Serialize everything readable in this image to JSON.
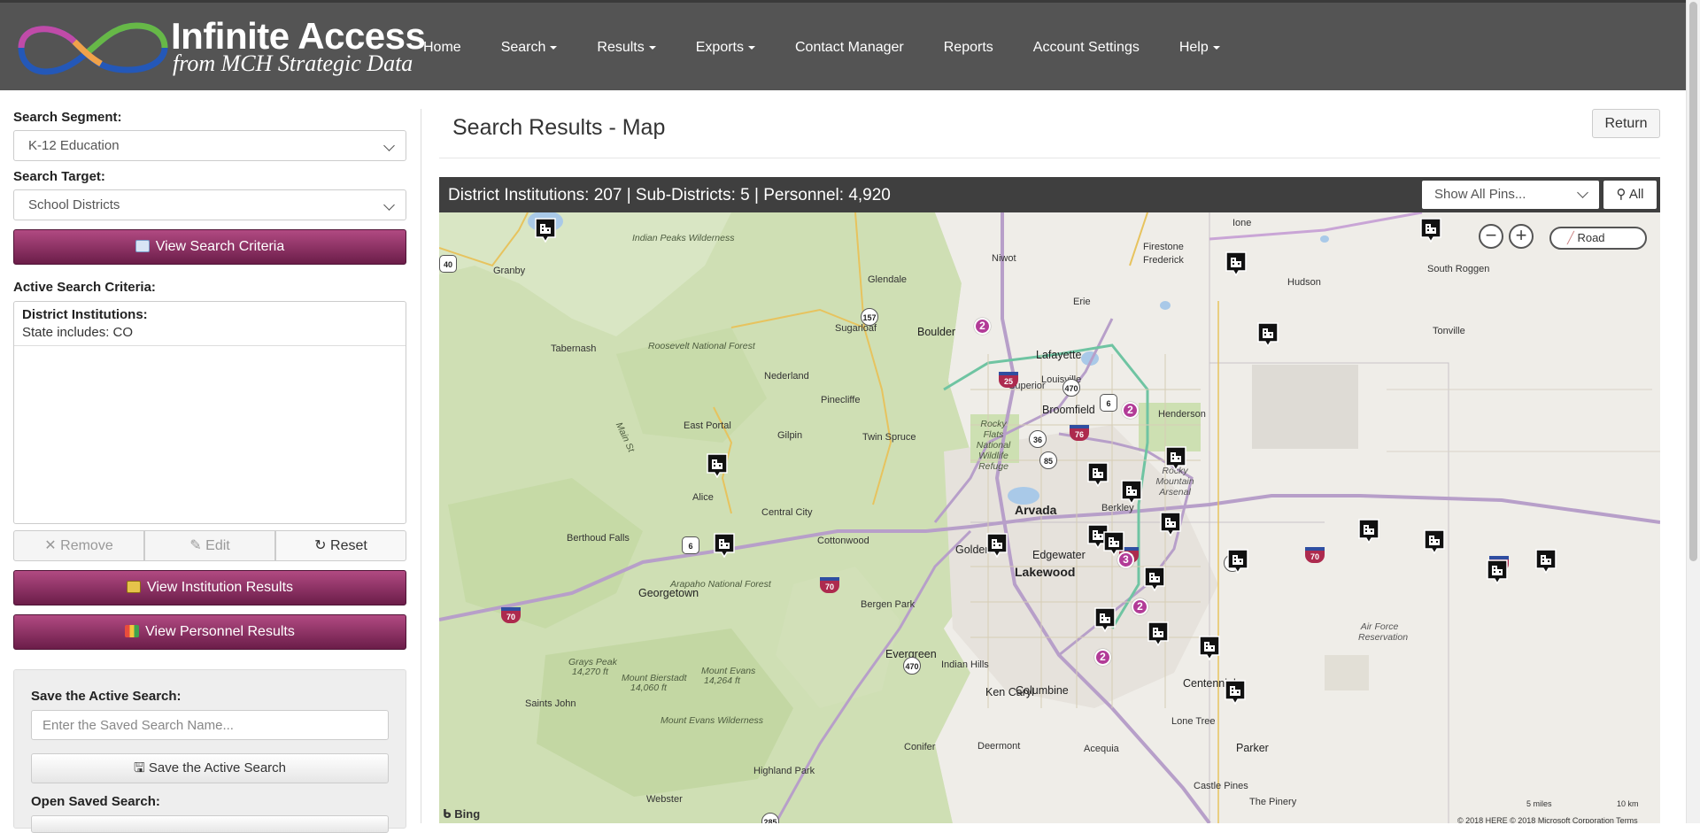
{
  "app": {
    "logo_title": "Infinite Access",
    "logo_subtitle": "from MCH Strategic Data"
  },
  "nav": {
    "items": [
      {
        "label": "Home",
        "dropdown": false
      },
      {
        "label": "Search",
        "dropdown": true
      },
      {
        "label": "Results",
        "dropdown": true
      },
      {
        "label": "Exports",
        "dropdown": true
      },
      {
        "label": "Contact Manager",
        "dropdown": false
      },
      {
        "label": "Reports",
        "dropdown": false
      },
      {
        "label": "Account Settings",
        "dropdown": false
      },
      {
        "label": "Help",
        "dropdown": true
      }
    ]
  },
  "sidebar": {
    "segment_label": "Search Segment:",
    "segment_value": "K-12 Education",
    "target_label": "Search Target:",
    "target_value": "School Districts",
    "view_criteria_button": "View Search Criteria",
    "active_criteria_label": "Active Search Criteria:",
    "criteria": [
      {
        "title": "District Institutions:",
        "value": "State includes: CO"
      }
    ],
    "remove_button": "Remove",
    "edit_button": "Edit",
    "reset_button": "Reset",
    "institution_results_button": "View Institution Results",
    "personnel_results_button": "View Personnel Results",
    "save_label": "Save the Active Search:",
    "save_placeholder": "Enter the Saved Search Name...",
    "save_button": "Save the Active Search",
    "open_label": "Open Saved Search:"
  },
  "main": {
    "title": "Search Results - Map",
    "return_button": "Return",
    "stats": "District Institutions: 207 | Sub-Districts: 5 | Personnel: 4,920",
    "pins_filter_value": "Show All Pins...",
    "all_button": "All",
    "map_type": "Road"
  },
  "map": {
    "attribution": "Bing",
    "copyright": "© 2018 HERE © 2018 Microsoft Corporation  Terms",
    "scale_miles": "5 miles",
    "scale_km": "10 km",
    "places": [
      {
        "name": "Arvada",
        "style": "big"
      },
      {
        "name": "Lakewood",
        "style": "big"
      },
      {
        "name": "Boulder",
        "style": "med"
      },
      {
        "name": "Lafayette",
        "style": "med"
      },
      {
        "name": "Broomfield",
        "style": "med"
      },
      {
        "name": "Centennial",
        "style": "med"
      },
      {
        "name": "Golden",
        "style": "med"
      },
      {
        "name": "Edgewater",
        "style": "med"
      },
      {
        "name": "Ken Caryl",
        "style": "med"
      },
      {
        "name": "Columbine",
        "style": "med"
      },
      {
        "name": "Parker",
        "style": "med"
      },
      {
        "name": "Evergreen",
        "style": "med"
      },
      {
        "name": "Georgetown",
        "style": "med"
      },
      {
        "name": "Granby",
        "style": ""
      },
      {
        "name": "Tabernash",
        "style": ""
      },
      {
        "name": "Niwot",
        "style": ""
      },
      {
        "name": "Glendale",
        "style": ""
      },
      {
        "name": "Erie",
        "style": ""
      },
      {
        "name": "Firestone",
        "style": ""
      },
      {
        "name": "Frederick",
        "style": ""
      },
      {
        "name": "Ione",
        "style": ""
      },
      {
        "name": "Hudson",
        "style": ""
      },
      {
        "name": "South Roggen",
        "style": ""
      },
      {
        "name": "Tonville",
        "style": ""
      },
      {
        "name": "Sugarloaf",
        "style": ""
      },
      {
        "name": "Nederland",
        "style": ""
      },
      {
        "name": "Louisville",
        "style": ""
      },
      {
        "name": "Superior",
        "style": ""
      },
      {
        "name": "Pinecliffe",
        "style": ""
      },
      {
        "name": "Henderson",
        "style": ""
      },
      {
        "name": "East Portal",
        "style": ""
      },
      {
        "name": "Gilpin",
        "style": ""
      },
      {
        "name": "Twin Spruce",
        "style": ""
      },
      {
        "name": "Berkley",
        "style": ""
      },
      {
        "name": "Alice",
        "style": ""
      },
      {
        "name": "Central City",
        "style": ""
      },
      {
        "name": "Berthoud Falls",
        "style": ""
      },
      {
        "name": "Cottonwood",
        "style": ""
      },
      {
        "name": "Bergen Park",
        "style": ""
      },
      {
        "name": "Indian Hills",
        "style": ""
      },
      {
        "name": "Saints John",
        "style": ""
      },
      {
        "name": "Lone Tree",
        "style": ""
      },
      {
        "name": "Conifer",
        "style": ""
      },
      {
        "name": "Deermont",
        "style": ""
      },
      {
        "name": "Acequia",
        "style": ""
      },
      {
        "name": "Highland Park",
        "style": ""
      },
      {
        "name": "Webster",
        "style": ""
      },
      {
        "name": "Castle Pines",
        "style": ""
      },
      {
        "name": "The Pinery",
        "style": ""
      }
    ],
    "features": [
      "Indian Peaks Wilderness",
      "Roosevelt National Forest",
      "Arapaho National Forest",
      "Mount Evans Wilderness",
      "Grays Peak",
      "14,270 ft",
      "Mount Bierstadt",
      "14,060 ft",
      "Mount Evans",
      "14,264 ft",
      "Rocky Flats National Wildlife Refuge",
      "Rocky Mountain Arsenal",
      "Air Force Reservation",
      "Main St"
    ],
    "highways": [
      "40",
      "157",
      "25",
      "470",
      "6",
      "36",
      "76",
      "85",
      "6",
      "70",
      "70",
      "70",
      "70",
      "40",
      "70",
      "470",
      "285"
    ],
    "clusters": [
      "2",
      "2",
      "3",
      "2",
      "2"
    ],
    "pin_count": 23
  },
  "colors": {
    "topbar": "#545454",
    "accent_purple": "#8c2f63",
    "cluster": "#b23b97",
    "map_green": "#c9dcaa",
    "map_base": "#eceae4"
  }
}
